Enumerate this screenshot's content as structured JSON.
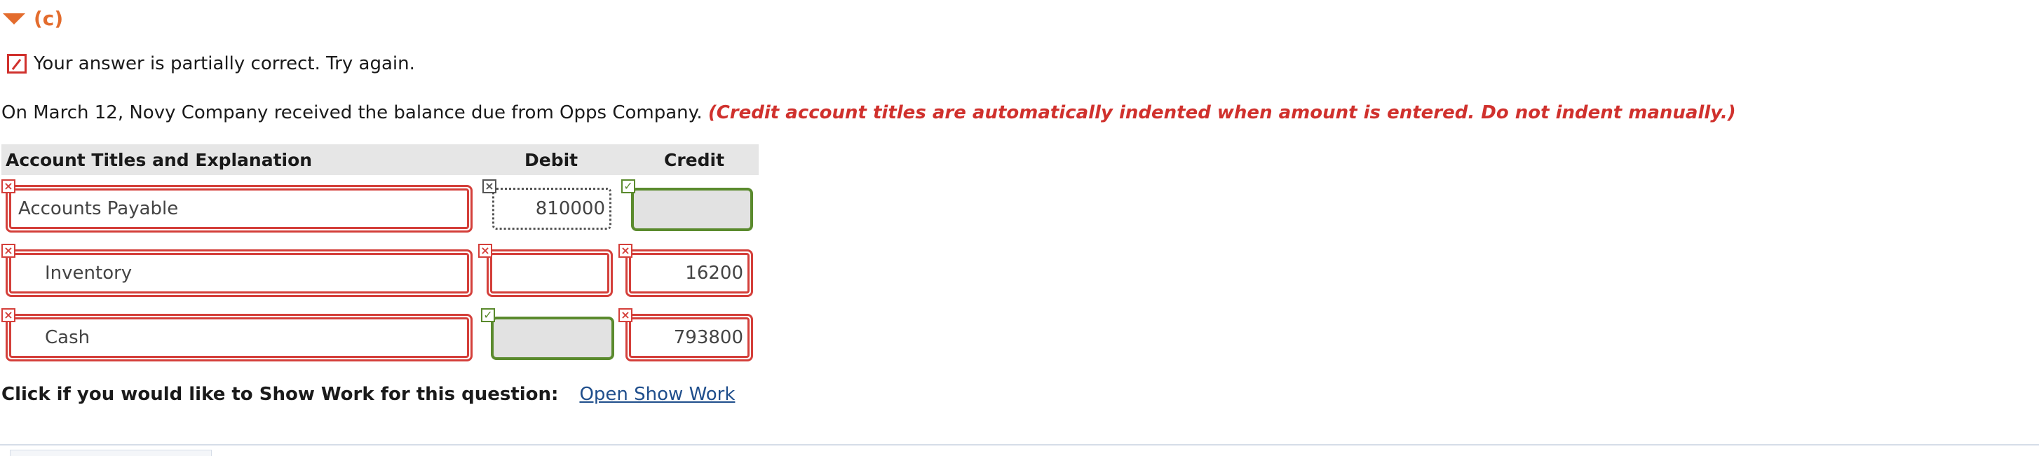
{
  "section": {
    "label": "(c)"
  },
  "status": {
    "message": "Your answer is partially correct.  Try again."
  },
  "question": {
    "text": "On March 12, Novy Company received the balance due from Opps Company.",
    "note": "(Credit account titles are automatically indented when amount is entered. Do not indent manually.)"
  },
  "table": {
    "headers": {
      "account": "Account Titles and Explanation",
      "debit": "Debit",
      "credit": "Credit"
    },
    "rows": [
      {
        "account": "Accounts Payable",
        "debit": "810000",
        "credit": ""
      },
      {
        "account": "Inventory",
        "debit": "",
        "credit": "16200"
      },
      {
        "account": "Cash",
        "debit": "",
        "credit": "793800"
      }
    ]
  },
  "marks": {
    "wrong": "×",
    "correct": "✓"
  },
  "show_work": {
    "label": "Click if you would like to Show Work for this question:",
    "link": "Open Show Work"
  },
  "colors": {
    "accent": "#e36c2d",
    "error": "#d43f3a",
    "success": "#5a8a2d",
    "link": "#1f4e8c"
  }
}
